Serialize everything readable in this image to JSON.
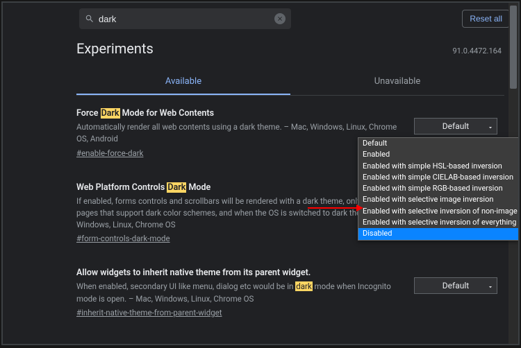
{
  "search": {
    "value": "dark",
    "placeholder": ""
  },
  "reset_label": "Reset all",
  "heading": "Experiments",
  "version": "91.0.4472.164",
  "tabs": {
    "available": "Available",
    "unavailable": "Unavailable"
  },
  "experiments": [
    {
      "title_pre": "Force ",
      "title_hl": "Dark",
      "title_post": " Mode for Web Contents",
      "desc": "Automatically render all web contents using a dark theme. – Mac, Windows, Linux, Chrome OS, Android",
      "anchor": "#enable-force-dark",
      "select": "Default"
    },
    {
      "title_pre": "Web Platform Controls ",
      "title_hl": "Dark",
      "title_post": " Mode",
      "desc": "If enabled, forms controls and scrollbars will be rendered with a dark theme, only on web pages that support dark color schemes, and when the OS is switched to dark theme. – Mac, Windows, Linux, Chrome OS",
      "anchor": "#form-controls-dark-mode",
      "select": ""
    },
    {
      "title_pre": "Allow widgets to inherit native theme from its parent widget.",
      "title_hl": "",
      "title_post": "",
      "desc_pre": "When enabled, secondary UI like menu, dialog etc would be in ",
      "desc_hl": "dark",
      "desc_post": " mode when Incognito mode is open. – Mac, Windows, Linux, Chrome OS",
      "anchor": "#inherit-native-theme-from-parent-widget",
      "select": "Default"
    }
  ],
  "dropdown": {
    "options": [
      "Default",
      "Enabled",
      "Enabled with simple HSL-based inversion",
      "Enabled with simple CIELAB-based inversion",
      "Enabled with simple RGB-based inversion",
      "Enabled with selective image inversion",
      "Enabled with selective inversion of non-image elements",
      "Enabled with selective inversion of everything",
      "Disabled"
    ],
    "selected_index": 8
  }
}
